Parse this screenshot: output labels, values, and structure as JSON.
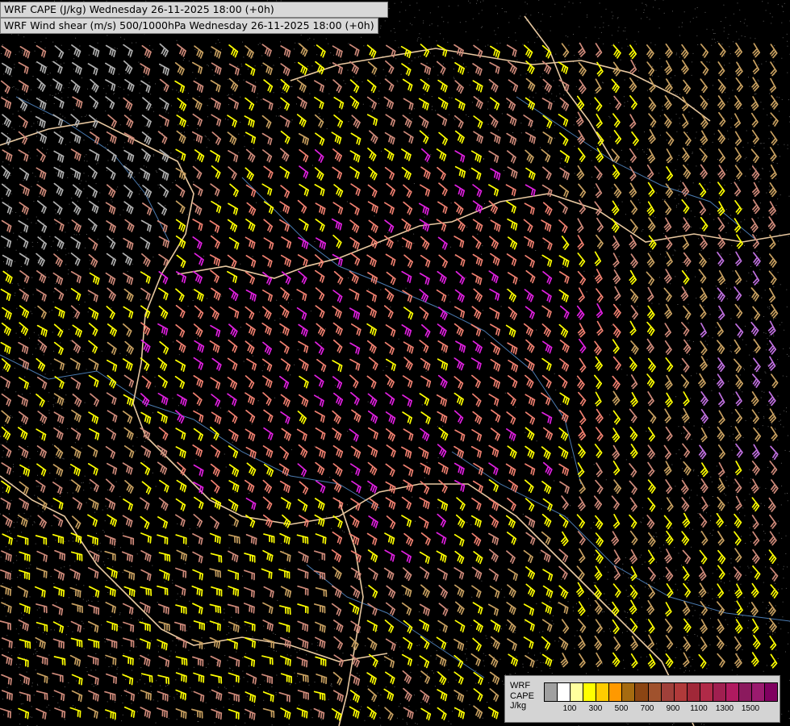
{
  "titles": {
    "line1": "WRF CAPE (J/kg) Wednesday 26-11-2025 18:00 (+0h)",
    "line2": "WRF Wind shear (m/s) 500/1000hPa Wednesday 26-11-2025 18:00 (+0h)"
  },
  "legend": {
    "line1": "WRF",
    "line2": "CAPE",
    "line3": "J/kg",
    "colors": [
      "#a0a0a0",
      "#ffffff",
      "#ffff9e",
      "#ffff00",
      "#ffcc00",
      "#ff9900",
      "#a56b10",
      "#8b4513",
      "#a0522d",
      "#a0403a",
      "#b03a3a",
      "#a02838",
      "#b02a48",
      "#a01f50",
      "#b01a60",
      "#8b1a5e",
      "#9a1a6e",
      "#800060"
    ],
    "tick_labels": [
      "100",
      "300",
      "500",
      "700",
      "900",
      "1100",
      "1300",
      "1500"
    ]
  },
  "map_colors": {
    "background": "#000000",
    "barb_low": "#cf8a7a",
    "barb_salmon": "#f08070",
    "barb_magenta": "#e020e0",
    "barb_yellow": "#ffff00",
    "barb_tan": "#c8a060",
    "barb_gray": "#b0b0b0",
    "barb_lavender": "#c070e0",
    "border": "#e8c8a0",
    "river": "#4a7ab0"
  }
}
